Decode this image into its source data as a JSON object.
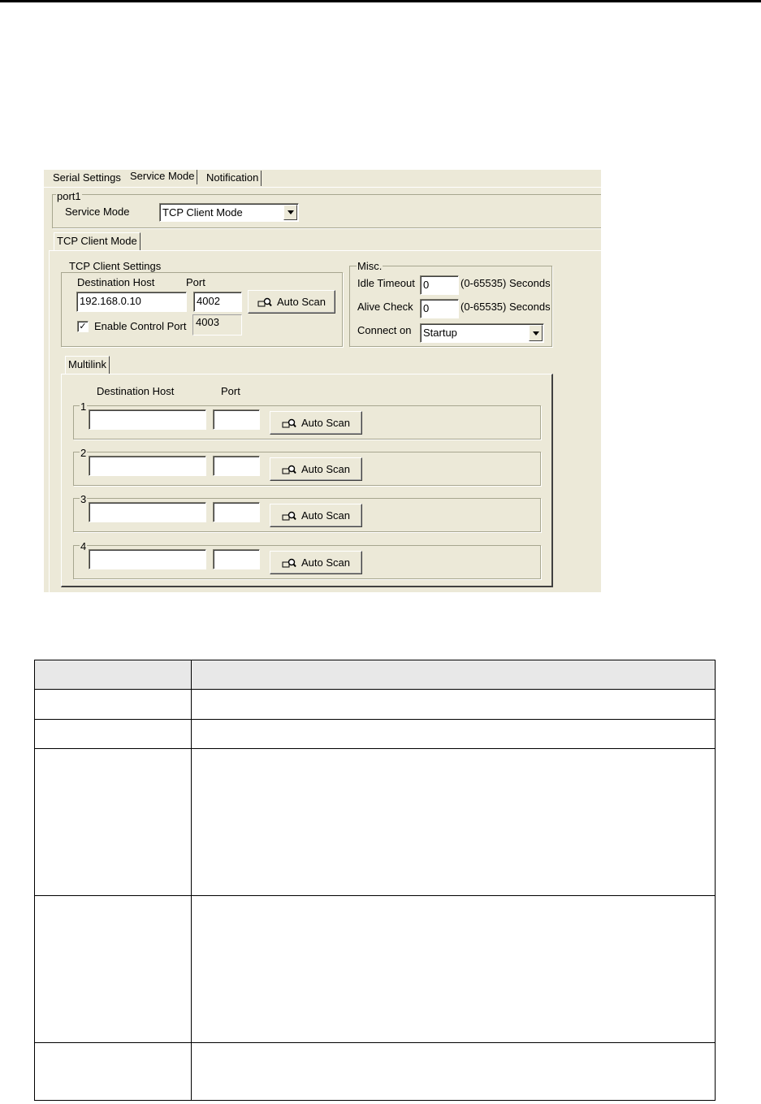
{
  "tabs": [
    "Serial Settings",
    "Service Mode",
    "Notification"
  ],
  "active_tab": "Service Mode",
  "port_group": {
    "legend": "port1",
    "service_mode_label": "Service Mode",
    "service_mode_value": "TCP Client Mode"
  },
  "sub_tab": "TCP Client Mode",
  "tcp_client_settings": {
    "legend": "TCP Client Settings",
    "destination_host_label": "Destination Host",
    "port_label": "Port",
    "destination_host_value": "192.168.0.10",
    "port_value": "4002",
    "auto_scan_label": "Auto Scan",
    "enable_control_port_label": "Enable Control Port",
    "enable_control_port_checked": true,
    "control_port_value": "4003"
  },
  "misc": {
    "legend": "Misc.",
    "idle_timeout_label": "Idle Timeout",
    "idle_timeout_value": "0",
    "idle_timeout_unit": "(0-65535) Seconds",
    "alive_check_label": "Alive Check",
    "alive_check_value": "0",
    "alive_check_unit": "(0-65535) Seconds",
    "connect_on_label": "Connect on",
    "connect_on_value": "Startup"
  },
  "multilink": {
    "tab_label": "Multilink",
    "destination_host_label": "Destination Host",
    "port_label": "Port",
    "rows": [
      {
        "index": "1",
        "host": "",
        "port": "",
        "button": "Auto Scan"
      },
      {
        "index": "2",
        "host": "",
        "port": "",
        "button": "Auto Scan"
      },
      {
        "index": "3",
        "host": "",
        "port": "",
        "button": "Auto Scan"
      },
      {
        "index": "4",
        "host": "",
        "port": "",
        "button": "Auto Scan"
      }
    ]
  },
  "colors": {
    "dialog_bg": "#ece9d8",
    "table_header_bg": "#e8e8e8"
  },
  "icons": [
    "magnifier-scan-icon",
    "chevron-down-icon",
    "checkmark-icon"
  ]
}
